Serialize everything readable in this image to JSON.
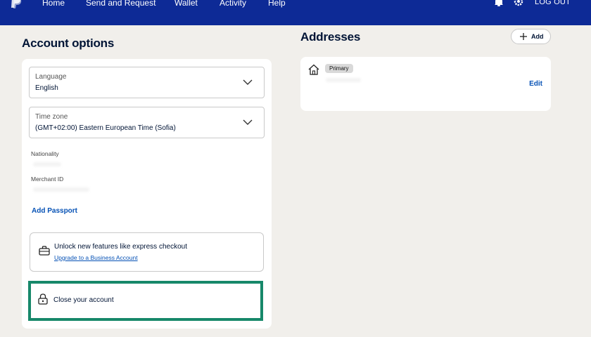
{
  "nav": {
    "items": [
      "Home",
      "Send and Request",
      "Wallet",
      "Activity",
      "Help"
    ],
    "logout": "LOG OUT"
  },
  "account": {
    "title": "Account options",
    "language": {
      "label": "Language",
      "value": "English"
    },
    "timezone": {
      "label": "Time zone",
      "value": "(GMT+02:00) Eastern European Time (Sofia)"
    },
    "nationality_label": "Nationality",
    "merchant_label": "Merchant ID",
    "add_passport": "Add Passport",
    "upgrade": {
      "title": "Unlock new features like express checkout",
      "link": "Upgrade to a Business Account"
    },
    "close_account": "Close your account"
  },
  "addresses": {
    "title": "Addresses",
    "add_label": "Add",
    "badge": "Primary",
    "edit": "Edit"
  },
  "colors": {
    "nav_bg": "#0d2a96",
    "link": "#0551b5",
    "highlight": "#17886a",
    "page_bg": "#f1efeb"
  }
}
